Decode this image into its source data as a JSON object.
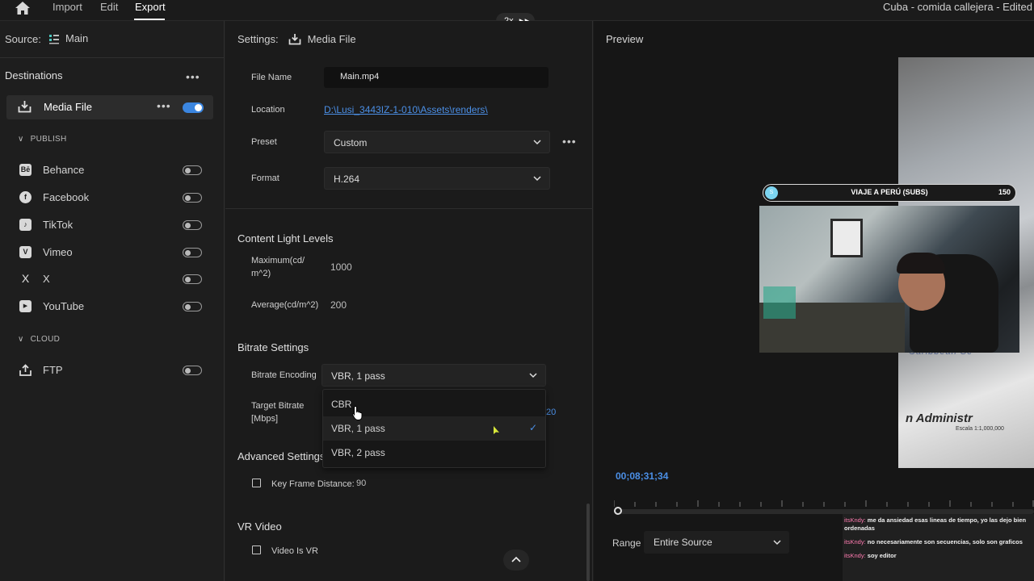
{
  "topbar": {
    "menu": [
      "Import",
      "Edit",
      "Export"
    ],
    "speed": "2x",
    "document_title": "Cuba - comida callejera - Edited"
  },
  "left": {
    "source_label": "Source:",
    "source_value": "Main",
    "destinations_title": "Destinations",
    "media_file": {
      "label": "Media File",
      "enabled": true
    },
    "publish_header": "PUBLISH",
    "publish_items": [
      {
        "label": "Behance",
        "icon": "behance-icon",
        "glyph": "Bē"
      },
      {
        "label": "Facebook",
        "icon": "facebook-icon",
        "glyph": "f"
      },
      {
        "label": "TikTok",
        "icon": "tiktok-icon",
        "glyph": "♪"
      },
      {
        "label": "Vimeo",
        "icon": "vimeo-icon",
        "glyph": "V"
      },
      {
        "label": "X",
        "icon": "x-icon",
        "glyph": "X"
      },
      {
        "label": "YouTube",
        "icon": "youtube-icon",
        "glyph": "▶"
      }
    ],
    "cloud_header": "CLOUD",
    "cloud_items": [
      {
        "label": "FTP",
        "icon": "upload-icon"
      }
    ]
  },
  "settings": {
    "header_label": "Settings:",
    "header_value": "Media File",
    "file_name_label": "File Name",
    "file_name_value": "Main.mp4",
    "location_label": "Location",
    "location_value": "D:\\Lusi_3443IZ-1-010\\Assets\\renders\\",
    "preset_label": "Preset",
    "preset_value": "Custom",
    "format_label": "Format",
    "format_value": "H.264",
    "content_light_title": "Content Light Levels",
    "max_label": "Maximum(cd/\nm^2)",
    "max_value": "1000",
    "avg_label": "Average(cd/m^2)",
    "avg_value": "200",
    "bitrate_title": "Bitrate Settings",
    "bitrate_encoding_label": "Bitrate Encoding",
    "bitrate_encoding_value": "VBR, 1 pass",
    "target_bitrate_label": "Target Bitrate\n[Mbps]",
    "target_bitrate_partial": "20",
    "encoding_options": [
      "CBR",
      "VBR, 1 pass",
      "VBR, 2 pass"
    ],
    "encoding_selected_index": 1,
    "advanced_title": "Advanced Settings",
    "keyframe_label": "Key Frame Distance:",
    "keyframe_value": "90",
    "vr_title": "VR Video",
    "vr_label": "Video Is VR"
  },
  "preview": {
    "title": "Preview",
    "overlay_bar_title": "VIAJE A PERÚ (SUBS)",
    "overlay_bar_count": "150",
    "overlay_dot": "S",
    "map_text": "n Administr",
    "map_scale": "Escala 1:1,000,000",
    "map_caribbean": "Caribbean Se",
    "timecode": "00;08;31;34",
    "range_label": "Range",
    "range_value": "Entire Source"
  },
  "chat": [
    {
      "user": "itsKndy:",
      "msg": "me da ansiedad esas lineas de tiempo, yo las dejo bien ordenadas"
    },
    {
      "user": "itsKndy:",
      "msg": "no necesariamente son secuencias, solo son graficos"
    },
    {
      "user": "itsKndy:",
      "msg": "soy editor"
    }
  ],
  "colors": {
    "accent": "#3b86e0",
    "link": "#4b8fe6",
    "chat_user": "#ff7bb0"
  }
}
